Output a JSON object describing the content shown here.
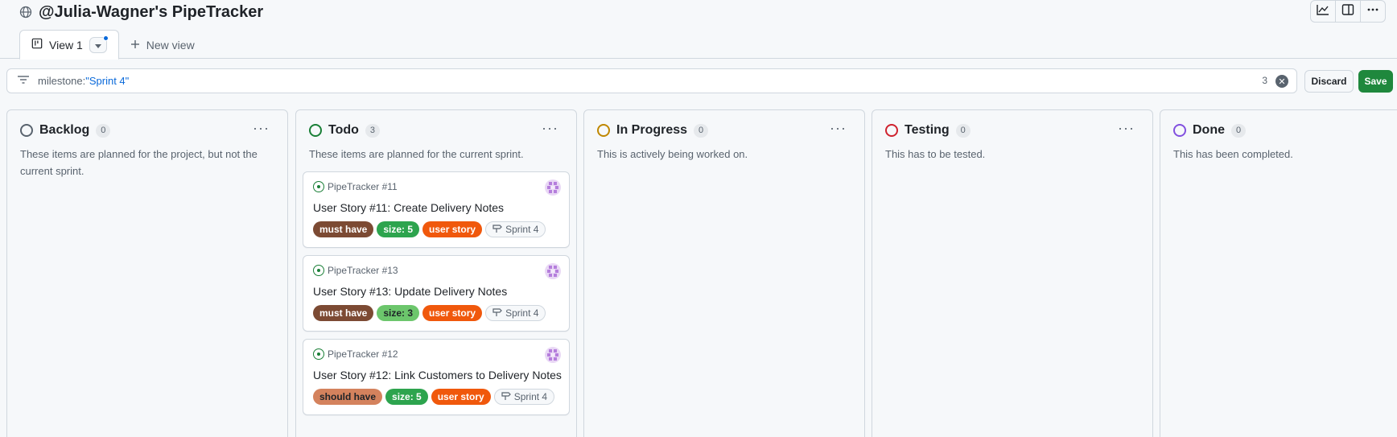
{
  "project": {
    "title": "@Julia-Wagner's PipeTracker"
  },
  "tabs": [
    {
      "label": "View 1",
      "icon": "board-icon",
      "active": true
    },
    {
      "label": "New view",
      "icon": "plus-icon",
      "active": false
    }
  ],
  "filter": {
    "prefix": "milestone:",
    "value": "\"Sprint 4\"",
    "count": "3"
  },
  "buttons": {
    "discard": "Discard",
    "save": "Save"
  },
  "colors": {
    "open_issue": "#1a7f37",
    "save_green": "#1f883d",
    "link_blue": "#0969da"
  },
  "columns": [
    {
      "name": "Backlog",
      "count": "0",
      "ring_color": "#59636e",
      "description": "These items are planned for the project, but not the current sprint.",
      "cards": []
    },
    {
      "name": "Todo",
      "count": "3",
      "ring_color": "#1a7f37",
      "description": "These items are planned for the current sprint.",
      "cards": [
        {
          "ref": "PipeTracker #11",
          "title": "User Story #11: Create Delivery Notes",
          "labels": [
            {
              "text": "must have",
              "bg": "#7c4a33",
              "fg": "#ffffff"
            },
            {
              "text": "size: 5",
              "bg": "#2da44e",
              "fg": "#ffffff"
            },
            {
              "text": "user story",
              "bg": "#f0580c",
              "fg": "#ffffff"
            }
          ],
          "milestone": "Sprint 4"
        },
        {
          "ref": "PipeTracker #13",
          "title": "User Story #13: Update Delivery Notes",
          "labels": [
            {
              "text": "must have",
              "bg": "#7c4a33",
              "fg": "#ffffff"
            },
            {
              "text": "size: 3",
              "bg": "#6cc66c",
              "fg": "#1f2328"
            },
            {
              "text": "user story",
              "bg": "#f0580c",
              "fg": "#ffffff"
            }
          ],
          "milestone": "Sprint 4"
        },
        {
          "ref": "PipeTracker #12",
          "title": "User Story #12: Link Customers to Delivery Notes",
          "labels": [
            {
              "text": "should have",
              "bg": "#d4825d",
              "fg": "#1f2328"
            },
            {
              "text": "size: 5",
              "bg": "#2da44e",
              "fg": "#ffffff"
            },
            {
              "text": "user story",
              "bg": "#f0580c",
              "fg": "#ffffff"
            }
          ],
          "milestone": "Sprint 4"
        }
      ]
    },
    {
      "name": "In Progress",
      "count": "0",
      "ring_color": "#bf8700",
      "description": "This is actively being worked on.",
      "cards": []
    },
    {
      "name": "Testing",
      "count": "0",
      "ring_color": "#cf222e",
      "description": "This has to be tested.",
      "cards": []
    },
    {
      "name": "Done",
      "count": "0",
      "ring_color": "#8250df",
      "description": "This has been completed.",
      "cards": []
    }
  ]
}
